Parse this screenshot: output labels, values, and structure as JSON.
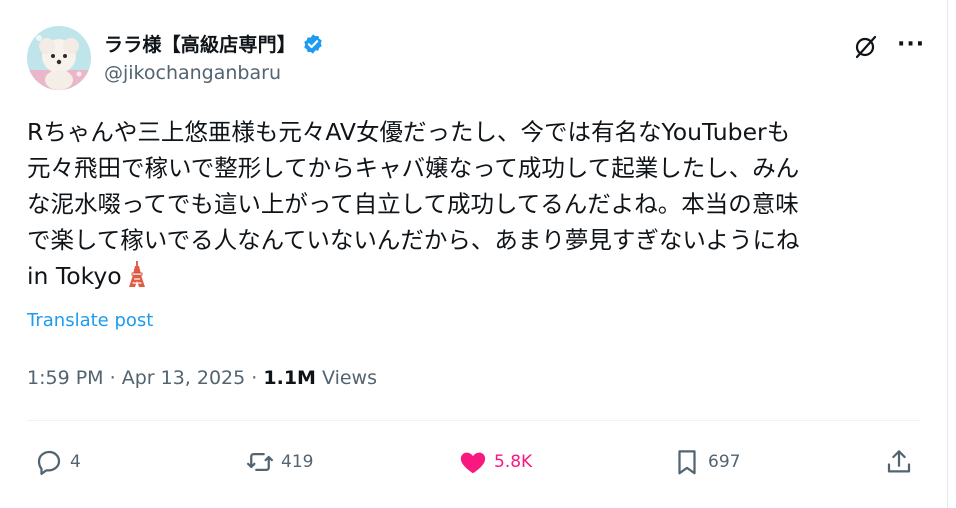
{
  "author": {
    "display_name": "ララ様【高級店専門】",
    "handle": "@jikochanganbaru",
    "verified": true,
    "verified_color": "#1d9bf0"
  },
  "tweet": {
    "lines": [
      "Rちゃんや三上悠亜様も元々AV女優だったし、今では有名なYouTuberも",
      "元々飛田で稼いで整形してからキャバ嬢なって成功して起業したし、みん",
      "な泥水啜ってでも這い上がって自立して成功してるんだよね。本当の意味",
      "で楽して稼いでる人なんていないんだから、あまり夢見すぎないようにね",
      "in Tokyo"
    ],
    "emoji_icon": "tokyo-tower-icon",
    "translate_label": "Translate post",
    "time": "1:59 PM",
    "separator": "·",
    "date": "Apr 13, 2025",
    "views_count": "1.1M",
    "views_label": "Views"
  },
  "actions": {
    "replies": "4",
    "reposts": "419",
    "likes": "5.8K",
    "bookmarks": "697"
  },
  "colors": {
    "accent": "#1d9bf0",
    "like": "#f91880",
    "muted": "#536471",
    "text": "#0f1419"
  }
}
